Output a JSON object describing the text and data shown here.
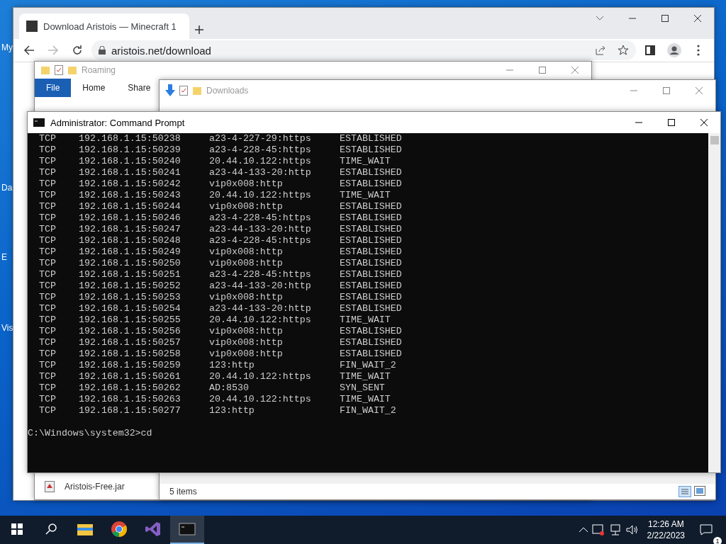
{
  "desktop_icons": [
    {
      "label": "My"
    },
    {
      "label": "Da"
    },
    {
      "label": "E"
    },
    {
      "label": "Vis"
    }
  ],
  "browser": {
    "tab": {
      "title": "Download Aristois — Minecraft 1",
      "selected": true
    },
    "url": "aristois.net/download"
  },
  "roaming_window": {
    "title": "Roaming",
    "ribbon_tabs": [
      {
        "label": "File",
        "selected": true
      },
      {
        "label": "Home",
        "selected": false
      },
      {
        "label": "Share",
        "selected": false
      }
    ],
    "file": "Aristois-Free.jar"
  },
  "downloads_window": {
    "title": "Downloads",
    "status": "5 items"
  },
  "console": {
    "title": "Administrator:  Command Prompt",
    "rows": [
      [
        "TCP",
        "192.168.1.15:50238",
        "a23-4-227-29:https",
        "ESTABLISHED"
      ],
      [
        "TCP",
        "192.168.1.15:50239",
        "a23-4-228-45:https",
        "ESTABLISHED"
      ],
      [
        "TCP",
        "192.168.1.15:50240",
        "20.44.10.122:https",
        "TIME_WAIT"
      ],
      [
        "TCP",
        "192.168.1.15:50241",
        "a23-44-133-20:http",
        "ESTABLISHED"
      ],
      [
        "TCP",
        "192.168.1.15:50242",
        "vip0x008:http",
        "ESTABLISHED"
      ],
      [
        "TCP",
        "192.168.1.15:50243",
        "20.44.10.122:https",
        "TIME_WAIT"
      ],
      [
        "TCP",
        "192.168.1.15:50244",
        "vip0x008:http",
        "ESTABLISHED"
      ],
      [
        "TCP",
        "192.168.1.15:50246",
        "a23-4-228-45:https",
        "ESTABLISHED"
      ],
      [
        "TCP",
        "192.168.1.15:50247",
        "a23-44-133-20:http",
        "ESTABLISHED"
      ],
      [
        "TCP",
        "192.168.1.15:50248",
        "a23-4-228-45:https",
        "ESTABLISHED"
      ],
      [
        "TCP",
        "192.168.1.15:50249",
        "vip0x008:http",
        "ESTABLISHED"
      ],
      [
        "TCP",
        "192.168.1.15:50250",
        "vip0x008:http",
        "ESTABLISHED"
      ],
      [
        "TCP",
        "192.168.1.15:50251",
        "a23-4-228-45:https",
        "ESTABLISHED"
      ],
      [
        "TCP",
        "192.168.1.15:50252",
        "a23-44-133-20:http",
        "ESTABLISHED"
      ],
      [
        "TCP",
        "192.168.1.15:50253",
        "vip0x008:http",
        "ESTABLISHED"
      ],
      [
        "TCP",
        "192.168.1.15:50254",
        "a23-44-133-20:http",
        "ESTABLISHED"
      ],
      [
        "TCP",
        "192.168.1.15:50255",
        "20.44.10.122:https",
        "TIME_WAIT"
      ],
      [
        "TCP",
        "192.168.1.15:50256",
        "vip0x008:http",
        "ESTABLISHED"
      ],
      [
        "TCP",
        "192.168.1.15:50257",
        "vip0x008:http",
        "ESTABLISHED"
      ],
      [
        "TCP",
        "192.168.1.15:50258",
        "vip0x008:http",
        "ESTABLISHED"
      ],
      [
        "TCP",
        "192.168.1.15:50259",
        "123:http",
        "FIN_WAIT_2"
      ],
      [
        "TCP",
        "192.168.1.15:50261",
        "20.44.10.122:https",
        "TIME_WAIT"
      ],
      [
        "TCP",
        "192.168.1.15:50262",
        "AD:8530",
        "SYN_SENT"
      ],
      [
        "TCP",
        "192.168.1.15:50263",
        "20.44.10.122:https",
        "TIME_WAIT"
      ],
      [
        "TCP",
        "192.168.1.15:50277",
        "123:http",
        "FIN_WAIT_2"
      ]
    ],
    "prompt": "C:\\Windows\\system32>cd"
  },
  "taskbar": {
    "apps": [
      {
        "kind": "explorer",
        "selected": false
      },
      {
        "kind": "chrome",
        "selected": false
      },
      {
        "kind": "studio",
        "selected": false
      },
      {
        "kind": "console",
        "selected": true
      }
    ],
    "time": "12:26 AM",
    "date": "2/22/2023",
    "notifications": "1"
  }
}
